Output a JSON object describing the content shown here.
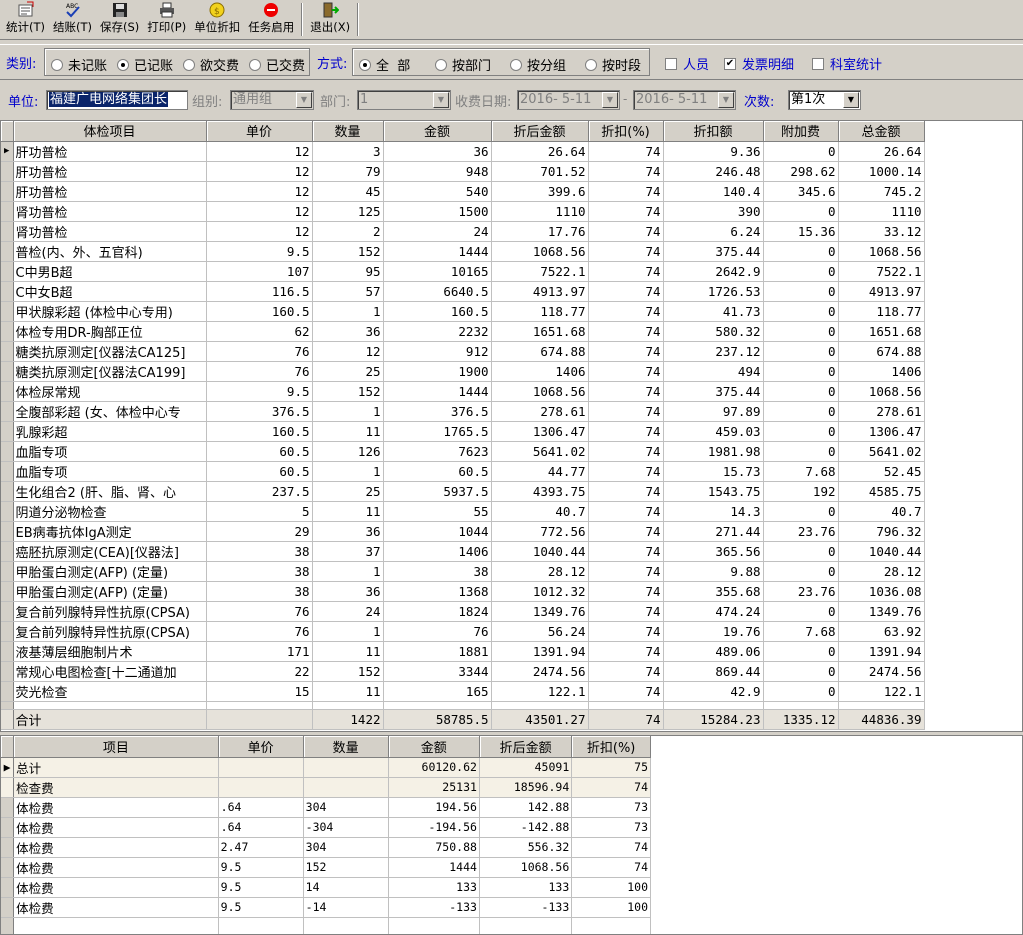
{
  "toolbar": {
    "buttons": [
      {
        "label": "统计(T)",
        "icon": "statistics-icon"
      },
      {
        "label": "结账(T)",
        "icon": "checkout-icon"
      },
      {
        "label": "保存(S)",
        "icon": "save-icon"
      },
      {
        "label": "打印(P)",
        "icon": "printer-icon"
      },
      {
        "label": "单位折扣",
        "icon": "coin-icon"
      },
      {
        "label": "任务启用",
        "icon": "stop-icon"
      },
      {
        "label": "退出(X)",
        "icon": "exit-door-icon"
      }
    ]
  },
  "filters": {
    "category_label": "类别:",
    "category_options": [
      "未记账",
      "已记账",
      "欲交费",
      "已交费"
    ],
    "category_selected": 1,
    "mode_label": "方式:",
    "mode_options": [
      "全  部",
      "按部门",
      "按分组",
      "按时段"
    ],
    "mode_selected": 0,
    "checkboxes": [
      {
        "label": "人员",
        "checked": false
      },
      {
        "label": "发票明细",
        "checked": true
      },
      {
        "label": "科室统计",
        "checked": false
      }
    ],
    "unit_label": "单位:",
    "unit_value": "福建广电网络集团长",
    "group_label": "组别:",
    "group_value": "通用组",
    "dept_label": "部门:",
    "dept_value": "1",
    "date_label": "收费日期:",
    "date_from": "2016- 5-11",
    "date_sep": "-",
    "date_to": "2016- 5-11",
    "times_label": "次数:",
    "times_value": "第1次"
  },
  "main_table": {
    "headers": [
      "体检项目",
      "单价",
      "数量",
      "金额",
      "折后金额",
      "折扣(%)",
      "折扣额",
      "附加费",
      "总金额"
    ],
    "rows": [
      [
        "肝功普检",
        "12",
        "3",
        "36",
        "26.64",
        "74",
        "9.36",
        "0",
        "26.64"
      ],
      [
        "肝功普检",
        "12",
        "79",
        "948",
        "701.52",
        "74",
        "246.48",
        "298.62",
        "1000.14"
      ],
      [
        "肝功普检",
        "12",
        "45",
        "540",
        "399.6",
        "74",
        "140.4",
        "345.6",
        "745.2"
      ],
      [
        "肾功普检",
        "12",
        "125",
        "1500",
        "1110",
        "74",
        "390",
        "0",
        "1110"
      ],
      [
        "肾功普检",
        "12",
        "2",
        "24",
        "17.76",
        "74",
        "6.24",
        "15.36",
        "33.12"
      ],
      [
        "普检(内、外、五官科)",
        "9.5",
        "152",
        "1444",
        "1068.56",
        "74",
        "375.44",
        "0",
        "1068.56"
      ],
      [
        "C中男B超",
        "107",
        "95",
        "10165",
        "7522.1",
        "74",
        "2642.9",
        "0",
        "7522.1"
      ],
      [
        "C中女B超",
        "116.5",
        "57",
        "6640.5",
        "4913.97",
        "74",
        "1726.53",
        "0",
        "4913.97"
      ],
      [
        "甲状腺彩超 (体检中心专用)",
        "160.5",
        "1",
        "160.5",
        "118.77",
        "74",
        "41.73",
        "0",
        "118.77"
      ],
      [
        "体检专用DR-胸部正位",
        "62",
        "36",
        "2232",
        "1651.68",
        "74",
        "580.32",
        "0",
        "1651.68"
      ],
      [
        "糖类抗原测定[仪器法CA125]",
        "76",
        "12",
        "912",
        "674.88",
        "74",
        "237.12",
        "0",
        "674.88"
      ],
      [
        "糖类抗原测定[仪器法CA199]",
        "76",
        "25",
        "1900",
        "1406",
        "74",
        "494",
        "0",
        "1406"
      ],
      [
        "体检尿常规",
        "9.5",
        "152",
        "1444",
        "1068.56",
        "74",
        "375.44",
        "0",
        "1068.56"
      ],
      [
        "全腹部彩超 (女、体检中心专",
        "376.5",
        "1",
        "376.5",
        "278.61",
        "74",
        "97.89",
        "0",
        "278.61"
      ],
      [
        "乳腺彩超",
        "160.5",
        "11",
        "1765.5",
        "1306.47",
        "74",
        "459.03",
        "0",
        "1306.47"
      ],
      [
        "血脂专项",
        "60.5",
        "126",
        "7623",
        "5641.02",
        "74",
        "1981.98",
        "0",
        "5641.02"
      ],
      [
        "血脂专项",
        "60.5",
        "1",
        "60.5",
        "44.77",
        "74",
        "15.73",
        "7.68",
        "52.45"
      ],
      [
        "生化组合2 (肝、脂、肾、心",
        "237.5",
        "25",
        "5937.5",
        "4393.75",
        "74",
        "1543.75",
        "192",
        "4585.75"
      ],
      [
        "阴道分泌物检查",
        "5",
        "11",
        "55",
        "40.7",
        "74",
        "14.3",
        "0",
        "40.7"
      ],
      [
        "EB病毒抗体IgA测定",
        "29",
        "36",
        "1044",
        "772.56",
        "74",
        "271.44",
        "23.76",
        "796.32"
      ],
      [
        "癌胚抗原测定(CEA)[仪器法]",
        "38",
        "37",
        "1406",
        "1040.44",
        "74",
        "365.56",
        "0",
        "1040.44"
      ],
      [
        "甲胎蛋白测定(AFP) (定量)",
        "38",
        "1",
        "38",
        "28.12",
        "74",
        "9.88",
        "0",
        "28.12"
      ],
      [
        "甲胎蛋白测定(AFP) (定量)",
        "38",
        "36",
        "1368",
        "1012.32",
        "74",
        "355.68",
        "23.76",
        "1036.08"
      ],
      [
        "复合前列腺特异性抗原(CPSA)",
        "76",
        "24",
        "1824",
        "1349.76",
        "74",
        "474.24",
        "0",
        "1349.76"
      ],
      [
        "复合前列腺特异性抗原(CPSA)",
        "76",
        "1",
        "76",
        "56.24",
        "74",
        "19.76",
        "7.68",
        "63.92"
      ],
      [
        "液基薄层细胞制片术",
        "171",
        "11",
        "1881",
        "1391.94",
        "74",
        "489.06",
        "0",
        "1391.94"
      ],
      [
        "常规心电图检查[十二通道加",
        "22",
        "152",
        "3344",
        "2474.56",
        "74",
        "869.44",
        "0",
        "2474.56"
      ],
      [
        "荧光检查",
        "15",
        "11",
        "165",
        "122.1",
        "74",
        "42.9",
        "0",
        "122.1"
      ]
    ],
    "total_row": [
      "合计",
      "",
      "1422",
      "58785.5",
      "43501.27",
      "74",
      "15284.23",
      "1335.12",
      "44836.39"
    ]
  },
  "summary_table": {
    "headers": [
      "项目",
      "单价",
      "数量",
      "金额",
      "折后金额",
      "折扣(%)"
    ],
    "rows": [
      [
        "总计",
        "",
        "",
        "60120.62",
        "45091",
        "75"
      ],
      [
        "检查费",
        "",
        "",
        "25131",
        "18596.94",
        "74"
      ],
      [
        "体检费",
        ".64",
        "304",
        "194.56",
        "142.88",
        "73"
      ],
      [
        "体检费",
        ".64",
        "-304",
        "-194.56",
        "-142.88",
        "73"
      ],
      [
        "体检费",
        "2.47",
        "304",
        "750.88",
        "556.32",
        "74"
      ],
      [
        "体检费",
        "9.5",
        "152",
        "1444",
        "1068.56",
        "74"
      ],
      [
        "体检费",
        "9.5",
        "14",
        "133",
        "133",
        "100"
      ],
      [
        "体检费",
        "9.5",
        "-14",
        "-133",
        "-133",
        "100"
      ]
    ]
  }
}
